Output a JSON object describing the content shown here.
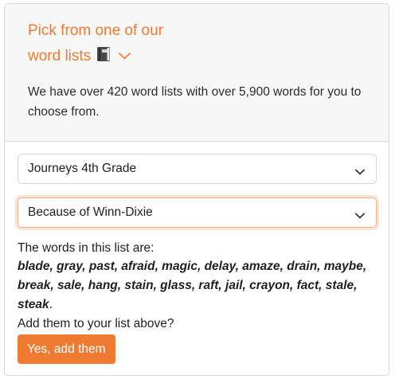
{
  "header": {
    "title_line1": "Pick from one of our",
    "title_line2": "word lists",
    "book_icon": "book-icon",
    "chevron_icon": "chevron-down-icon",
    "description": "We have over 420 word lists with over 5,900 words for you to choose from."
  },
  "selects": {
    "grade": {
      "value": "Journeys 4th Grade"
    },
    "story": {
      "value": "Because of Winn-Dixie"
    }
  },
  "words_section": {
    "intro": "The words in this list are:",
    "words": "blade, gray, past, afraid, magic, delay, amaze, drain, maybe, break, sale, hang, stain, glass, raft, jail, crayon, fact, stale, steak",
    "period": ".",
    "prompt": "Add them to your list above?",
    "button_label": "Yes, add them"
  },
  "colors": {
    "accent": "#ef7b33",
    "header_bg": "#f7f7f7",
    "focus_ring": "#f3b38c"
  }
}
